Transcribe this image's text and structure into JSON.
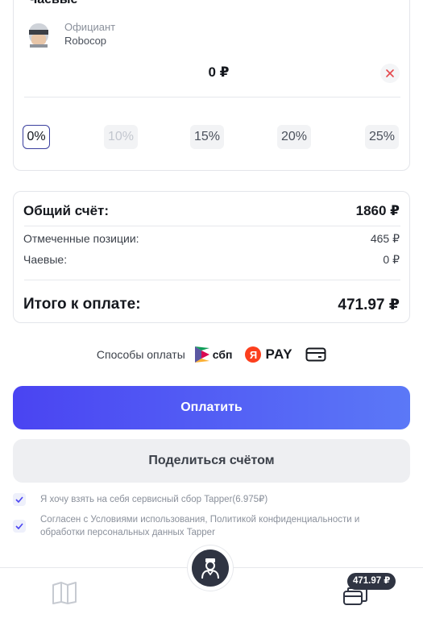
{
  "tips": {
    "title": "Чаевые",
    "waiter_role": "Официант",
    "waiter_name": "Robocop",
    "amount": "0 ₽",
    "percent_options": [
      "0%",
      "10%",
      "15%",
      "20%",
      "25%"
    ],
    "selected_percent": "0%"
  },
  "bill": {
    "total_label": "Общий счёт:",
    "total_value": "1860 ₽",
    "selected_label": "Отмеченные позиции:",
    "selected_value": "465 ₽",
    "tips_label": "Чаевые:",
    "tips_value": "0 ₽",
    "grand_label": "Итого к оплате:",
    "grand_value": "471.97 ₽"
  },
  "payment": {
    "label": "Способы оплаты",
    "sbp": "сбп",
    "yandex_letter": "Я",
    "yandex_pay": "PAY",
    "icons": [
      "sbp-icon",
      "yandex-pay-icon",
      "card-icon"
    ]
  },
  "buttons": {
    "pay": "Оплатить",
    "share": "Поделиться счётом"
  },
  "consents": {
    "service_fee": "Я хочу взять на себя сервисный сбор Tapper(6.975₽)",
    "terms": "Согласен с Условиями использования, Политикой конфиденциальности и обработки персональных данных Tapper"
  },
  "bottom_nav": {
    "cart_total": "471.97 ₽",
    "icons": [
      "menu-book-icon",
      "waiter-icon",
      "cart-icon"
    ]
  },
  "colors": {
    "accent_start": "#4a44f2",
    "accent_end": "#5b78f7",
    "dark": "#2f3442",
    "yandex_red": "#fc3f1d"
  }
}
